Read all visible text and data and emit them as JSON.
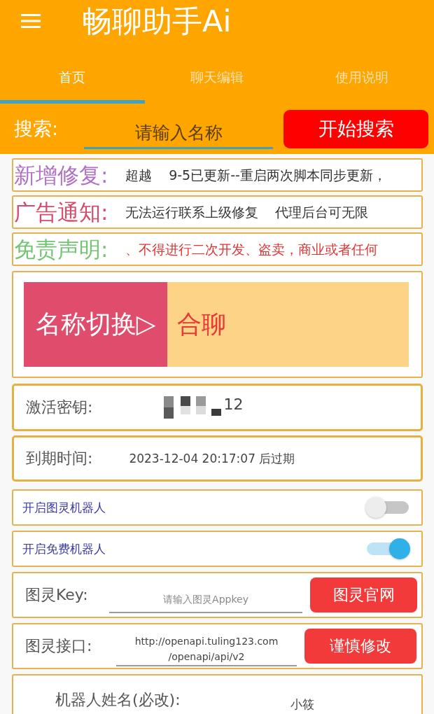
{
  "app_bar": {
    "title": "畅聊助手Ai"
  },
  "tabs": [
    {
      "label": "首页",
      "selected": true
    },
    {
      "label": "聊天编辑",
      "selected": false
    },
    {
      "label": "使用说明",
      "selected": false
    }
  ],
  "search": {
    "label": "搜索:",
    "placeholder": "请输入名称",
    "button": "开始搜索"
  },
  "notices": [
    {
      "kind": "update",
      "label": "新增修复:",
      "text": "超越    9-5已更新--重启两次脚本同步更新，"
    },
    {
      "kind": "ad",
      "label": "广告通知:",
      "text": "无法运行联系上级修复    代理后台可无限"
    },
    {
      "kind": "disclaimer",
      "label": "免责声明:",
      "text": "、不得进行二次开发、盗卖，商业或者任何"
    }
  ],
  "name_switch": {
    "button": "名称切换▷",
    "value": "合聊"
  },
  "activation": {
    "label": "激活密钥:",
    "value": "12"
  },
  "expiry": {
    "label": "到期时间:",
    "value": "2023-12-04 20:17:07 后过期"
  },
  "toggles": [
    {
      "label": "开启图灵机器人",
      "on": false
    },
    {
      "label": "开启免费机器人",
      "on": true
    }
  ],
  "tuling_key": {
    "label": "图灵Key:",
    "placeholder": "请输入图灵Appkey",
    "button": "图灵官网"
  },
  "tuling_api": {
    "label": "图灵接口:",
    "value": "http://openapi.tuling123.com\n/openapi/api/v2",
    "button": "谨慎修改"
  },
  "robot_name": {
    "label": "机器人姓名(必改):",
    "value": "小筱"
  }
}
